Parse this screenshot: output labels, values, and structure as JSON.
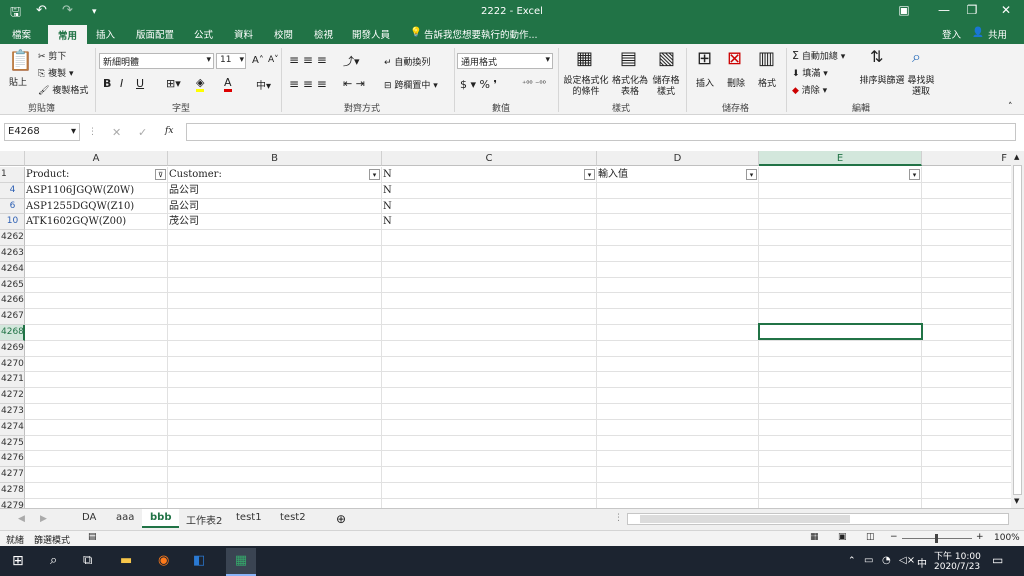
{
  "app": {
    "title": "2222 - Excel"
  },
  "quick_access": {
    "save_icon": "🖫",
    "undo_icon": "↶",
    "redo_icon": "↷",
    "custom_icon": "▾"
  },
  "window_controls": {
    "ribbon_display": "▣",
    "minimize": "—",
    "restore": "❐",
    "close": "✕"
  },
  "tabs": [
    "檔案",
    "常用",
    "插入",
    "版面配置",
    "公式",
    "資料",
    "校閱",
    "檢視",
    "開發人員"
  ],
  "tell_me": "告訴我您想要執行的動作...",
  "account": {
    "signin": "登入",
    "share": "共用"
  },
  "ribbon": {
    "clipboard": {
      "label": "剪貼簿",
      "paste": "貼上",
      "cut": "剪下",
      "copy": "複製",
      "format_painter": "複製格式"
    },
    "font": {
      "label": "字型",
      "name": "新細明體",
      "size": "11",
      "bold": "B",
      "italic": "I",
      "underline": "U"
    },
    "alignment": {
      "label": "對齊方式",
      "wrap": "自動換列",
      "merge": "跨欄置中"
    },
    "number": {
      "label": "數值",
      "format": "通用格式"
    },
    "styles": {
      "label": "樣式",
      "conditional": "設定格式化的條件",
      "table": "格式化為表格",
      "cell_styles": "儲存格樣式"
    },
    "cells": {
      "label": "儲存格",
      "insert": "插入",
      "delete": "刪除",
      "format": "格式"
    },
    "editing": {
      "label": "編輯",
      "autosum": "自動加總",
      "fill": "填滿",
      "clear": "清除",
      "sort": "排序與篩選",
      "find": "尋找與選取"
    }
  },
  "formula_bar": {
    "name_box": "E4268",
    "fx": "fx",
    "value": ""
  },
  "columns": [
    "A",
    "B",
    "C",
    "D",
    "E",
    "F"
  ],
  "rows": [
    {
      "num": "1",
      "cells": [
        "Product:",
        "Customer:",
        "N",
        "輸入值",
        ""
      ],
      "header": true
    },
    {
      "num": "4",
      "cells": [
        "ASP1106JGQW(Z0W)",
        "品公司",
        "N",
        "",
        ""
      ],
      "filtered": true
    },
    {
      "num": "6",
      "cells": [
        "ASP1255DGQW(Z10)",
        "品公司",
        "N",
        "",
        ""
      ],
      "filtered": true
    },
    {
      "num": "10",
      "cells": [
        "ATK1602GQW(Z00)",
        "茂公司",
        "N",
        "",
        ""
      ],
      "filtered": true
    },
    {
      "num": "4262",
      "cells": [
        "",
        "",
        "",
        "",
        ""
      ]
    },
    {
      "num": "4263",
      "cells": [
        "",
        "",
        "",
        "",
        ""
      ]
    },
    {
      "num": "4264",
      "cells": [
        "",
        "",
        "",
        "",
        ""
      ]
    },
    {
      "num": "4265",
      "cells": [
        "",
        "",
        "",
        "",
        ""
      ]
    },
    {
      "num": "4266",
      "cells": [
        "",
        "",
        "",
        "",
        ""
      ]
    },
    {
      "num": "4267",
      "cells": [
        "",
        "",
        "",
        "",
        ""
      ]
    },
    {
      "num": "4268",
      "cells": [
        "",
        "",
        "",
        "",
        ""
      ],
      "selected": true
    },
    {
      "num": "4269",
      "cells": [
        "",
        "",
        "",
        "",
        ""
      ]
    },
    {
      "num": "4270",
      "cells": [
        "",
        "",
        "",
        "",
        ""
      ]
    },
    {
      "num": "4271",
      "cells": [
        "",
        "",
        "",
        "",
        ""
      ]
    },
    {
      "num": "4272",
      "cells": [
        "",
        "",
        "",
        "",
        ""
      ]
    },
    {
      "num": "4273",
      "cells": [
        "",
        "",
        "",
        "",
        ""
      ]
    },
    {
      "num": "4274",
      "cells": [
        "",
        "",
        "",
        "",
        ""
      ]
    },
    {
      "num": "4275",
      "cells": [
        "",
        "",
        "",
        "",
        ""
      ]
    },
    {
      "num": "4276",
      "cells": [
        "",
        "",
        "",
        "",
        ""
      ]
    },
    {
      "num": "4277",
      "cells": [
        "",
        "",
        "",
        "",
        ""
      ]
    },
    {
      "num": "4278",
      "cells": [
        "",
        "",
        "",
        "",
        ""
      ]
    },
    {
      "num": "4279",
      "cells": [
        "",
        "",
        "",
        "",
        ""
      ]
    }
  ],
  "sheets": [
    "DA",
    "aaa",
    "bbb",
    "工作表2",
    "test1",
    "test2"
  ],
  "active_sheet": "bbb",
  "status": {
    "ready": "就緒",
    "filter_mode": "篩選模式",
    "zoom": "100%"
  },
  "taskbar": {
    "time": "下午 10:00",
    "date": "2020/7/23",
    "ime": "中"
  },
  "colors": {
    "accent": "#217346",
    "selection": "#217346",
    "row_filtered": "#2c5fb3"
  }
}
